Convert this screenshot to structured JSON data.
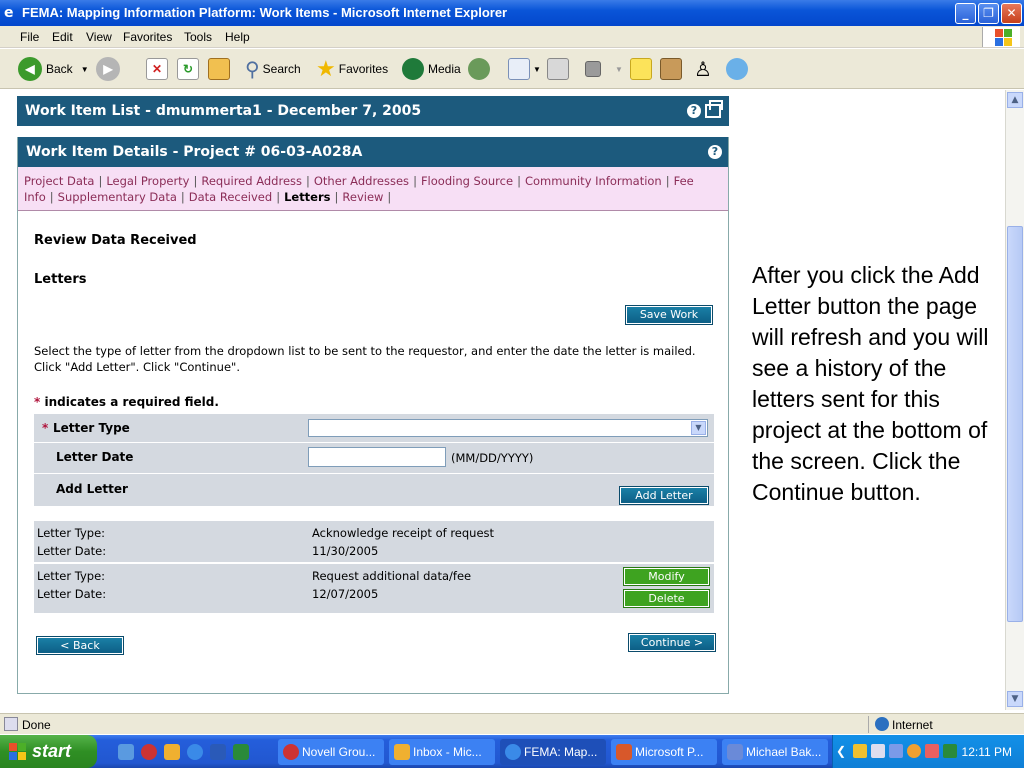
{
  "window": {
    "title": "FEMA: Mapping Information Platform: Work Items - Microsoft Internet Explorer",
    "buttons": [
      "_",
      "❐",
      "✕"
    ]
  },
  "menubar": {
    "items": [
      "File",
      "Edit",
      "View",
      "Favorites",
      "Tools",
      "Help"
    ]
  },
  "toolbar": {
    "back": "Back",
    "search": "Search",
    "favorites": "Favorites",
    "media": "Media"
  },
  "work_item_list": {
    "title": "Work Item List - dmummerta1 - December 7, 2005"
  },
  "details": {
    "title": "Work Item Details - Project # 06-03-A028A",
    "tabs_line1": [
      "Project Data",
      "Legal Property",
      "Required Address",
      "Other Addresses",
      "Flooding Source",
      "Community Information",
      "Fee"
    ],
    "tabs_line2": [
      "Info",
      "Supplementary Data",
      "Data Received",
      "Letters",
      "Review"
    ],
    "section_heading": "Review Data Received",
    "subheading": "Letters",
    "save_work": "Save Work",
    "instructions": "Select the type of letter from the dropdown list to be sent to the requestor, and enter the date the letter is mailed. Click \"Add Letter\". Click \"Continue\".",
    "required_star": "*",
    "required_note": "indicates a required field.",
    "form": {
      "letter_type_label": "Letter Type",
      "letter_type_value": "",
      "letter_date_label": "Letter Date",
      "letter_date_value": "",
      "date_format": "(MM/DD/YYYY)",
      "add_letter_label": "Add Letter",
      "add_letter_button": "Add Letter"
    },
    "history": [
      {
        "type_label": "Letter Type:",
        "type_value": "Acknowledge receipt of request",
        "date_label": "Letter Date:",
        "date_value": "11/30/2005"
      },
      {
        "type_label": "Letter Type:",
        "type_value": "Request additional data/fee",
        "date_label": "Letter Date:",
        "date_value": "12/07/2005",
        "modify": "Modify",
        "delete": "Delete"
      }
    ],
    "back_button": "< Back",
    "continue_button": "Continue >"
  },
  "side_note": "After you click the Add Letter button the page will refresh and you will see a history of the letters sent for this project at the bottom of the screen. Click the Continue button.",
  "statusbar": {
    "status": "Done",
    "zone": "Internet"
  },
  "taskbar": {
    "start": "start",
    "tasks": [
      "Novell Grou...",
      "Inbox - Mic...",
      "FEMA: Map...",
      "Microsoft P...",
      "Michael Bak..."
    ],
    "clock": "12:11 PM"
  }
}
